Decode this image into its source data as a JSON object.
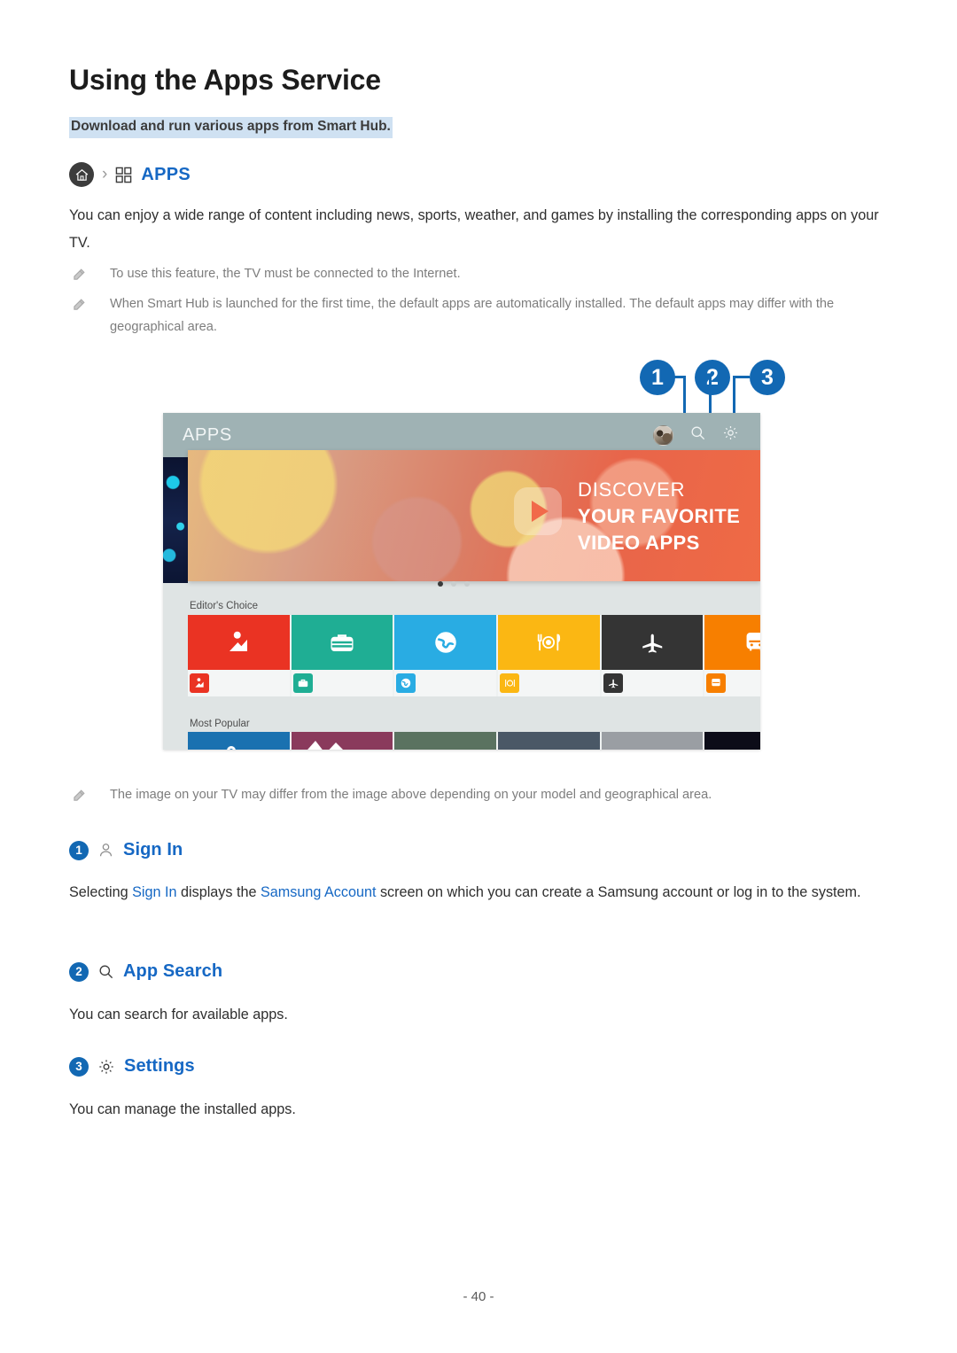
{
  "document": {
    "title": "Using the Apps Service",
    "subtitle": "Download and run various apps from Smart Hub.",
    "page_number": "- 40 -"
  },
  "breadcrumb": {
    "home_icon": "home-icon",
    "separator": "›",
    "grid_icon": "apps-grid-icon",
    "label": "APPS",
    "link_color": "#1668c4"
  },
  "intro": {
    "paragraph": "You can enjoy a wide range of content including news, sports, weather, and games by installing the corresponding apps on your TV."
  },
  "notes": [
    {
      "icon": "pencil-icon",
      "text": "To use this feature, the TV must be connected to the Internet."
    },
    {
      "icon": "pencil-icon",
      "text": "When Smart Hub is launched for the first time, the default apps are automatically installed. The default apps may differ with the geographical area."
    },
    {
      "icon": "pencil-icon",
      "text": "The image on your TV may differ from the image above depending on your model and geographical area."
    }
  ],
  "callouts": [
    {
      "number": "1",
      "target": "sign-in-avatar"
    },
    {
      "number": "2",
      "target": "app-search-icon"
    },
    {
      "number": "3",
      "target": "settings-gear-icon"
    }
  ],
  "tv_screen": {
    "header_label": "APPS",
    "header_color": "#9fb2b4",
    "icons": [
      {
        "name": "user-avatar",
        "label": "Sign In"
      },
      {
        "name": "search-icon",
        "label": "App Search"
      },
      {
        "name": "gear-icon",
        "label": "Settings"
      }
    ],
    "banner": {
      "line1": "DISCOVER",
      "line2": "YOUR FAVORITE",
      "line3": "VIDEO APPS",
      "play_icon": "play-icon",
      "dots": [
        true,
        false,
        false
      ]
    },
    "sections": [
      {
        "label": "Editor's Choice",
        "tiles": [
          {
            "icon": "map-person-icon",
            "color": "#ea3323"
          },
          {
            "icon": "briefcase-icon",
            "color": "#1fae94"
          },
          {
            "icon": "globe-icon",
            "color": "#29ace3"
          },
          {
            "icon": "dining-icon",
            "color": "#fbb713"
          },
          {
            "icon": "airplane-icon",
            "color": "#343434"
          },
          {
            "icon": "bus-icon",
            "color": "#f77f00"
          }
        ]
      },
      {
        "label": "Most Popular",
        "tiles": [
          {
            "icon": "gear-orange-icon",
            "color": "#1a71b0"
          },
          {
            "icon": "mountains-icon",
            "color": "#8a3a5c"
          },
          {
            "icon": "",
            "color": "#5a7260"
          },
          {
            "icon": "",
            "color": "#4a5866"
          },
          {
            "icon": "",
            "color": "#9a9ea3"
          },
          {
            "icon": "",
            "color": "#0c0c18"
          }
        ]
      }
    ]
  },
  "sections": [
    {
      "number": "1",
      "icon": "person-icon",
      "title": "Sign In",
      "body_before": "Selecting ",
      "keyword1": "Sign In",
      "body_mid": " displays the ",
      "keyword2": "Samsung Account",
      "body_after": " screen on which you can create a Samsung account or log in to the system."
    },
    {
      "number": "2",
      "icon": "search-icon",
      "title": "App Search",
      "body": "You can search for available apps."
    },
    {
      "number": "3",
      "icon": "gear-icon",
      "title": "Settings",
      "body": "You can manage the installed apps."
    }
  ]
}
